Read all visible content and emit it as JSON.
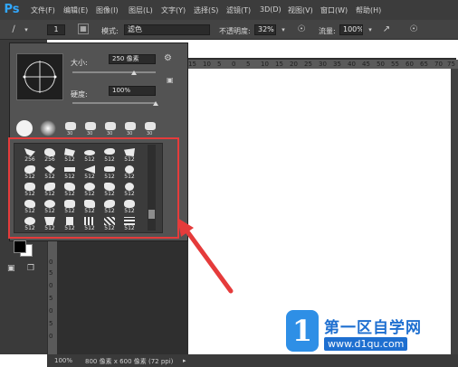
{
  "app": {
    "logo": "Ps",
    "accent": "#31a8ff"
  },
  "menu": [
    "文件(F)",
    "编辑(E)",
    "图像(I)",
    "图层(L)",
    "文字(Y)",
    "选择(S)",
    "滤镜(T)",
    "3D(D)",
    "视图(V)",
    "窗口(W)",
    "帮助(H)"
  ],
  "options": {
    "brush_size_small": "1",
    "mode_label": "模式:",
    "mode_value": "滤色",
    "opacity_label": "不透明度:",
    "opacity_value": "32%",
    "flow_label": "流量:",
    "flow_value": "100%"
  },
  "brush_panel": {
    "size_label": "大小:",
    "size_value": "250 像素",
    "hardness_label": "硬度:",
    "hardness_value": "100%",
    "recent_nums": [
      "",
      "",
      "30",
      "30",
      "30",
      "30",
      "30"
    ],
    "grid": [
      [
        "256",
        "256",
        "512",
        "512",
        "512",
        "512"
      ],
      [
        "512",
        "512",
        "512",
        "512",
        "512",
        "512"
      ],
      [
        "512",
        "512",
        "512",
        "512",
        "512",
        "512"
      ],
      [
        "512",
        "512",
        "512",
        "512",
        "512",
        "512"
      ],
      [
        "512",
        "512",
        "512",
        "512",
        "512",
        "512"
      ]
    ]
  },
  "ruler_top": [
    "15",
    "10",
    "5",
    "0",
    "5",
    "10",
    "15",
    "20",
    "25",
    "30",
    "35",
    "40",
    "45",
    "50",
    "55",
    "60",
    "65",
    "70",
    "75"
  ],
  "ruler_left": [
    "0",
    "5",
    "0",
    "5",
    "0",
    "5",
    "0",
    "5",
    "0",
    "5",
    "0",
    "5",
    "0",
    "5"
  ],
  "status": {
    "zoom": "100%",
    "doc_info": "800 像素 x 600 像素 (72 ppi)"
  },
  "watermark": {
    "logo": "1",
    "title": "第一区自学网",
    "url": "www.d1qu.com"
  },
  "colors": {
    "highlight": "#e53b3b",
    "watermark_blue": "#1e6fd0"
  }
}
